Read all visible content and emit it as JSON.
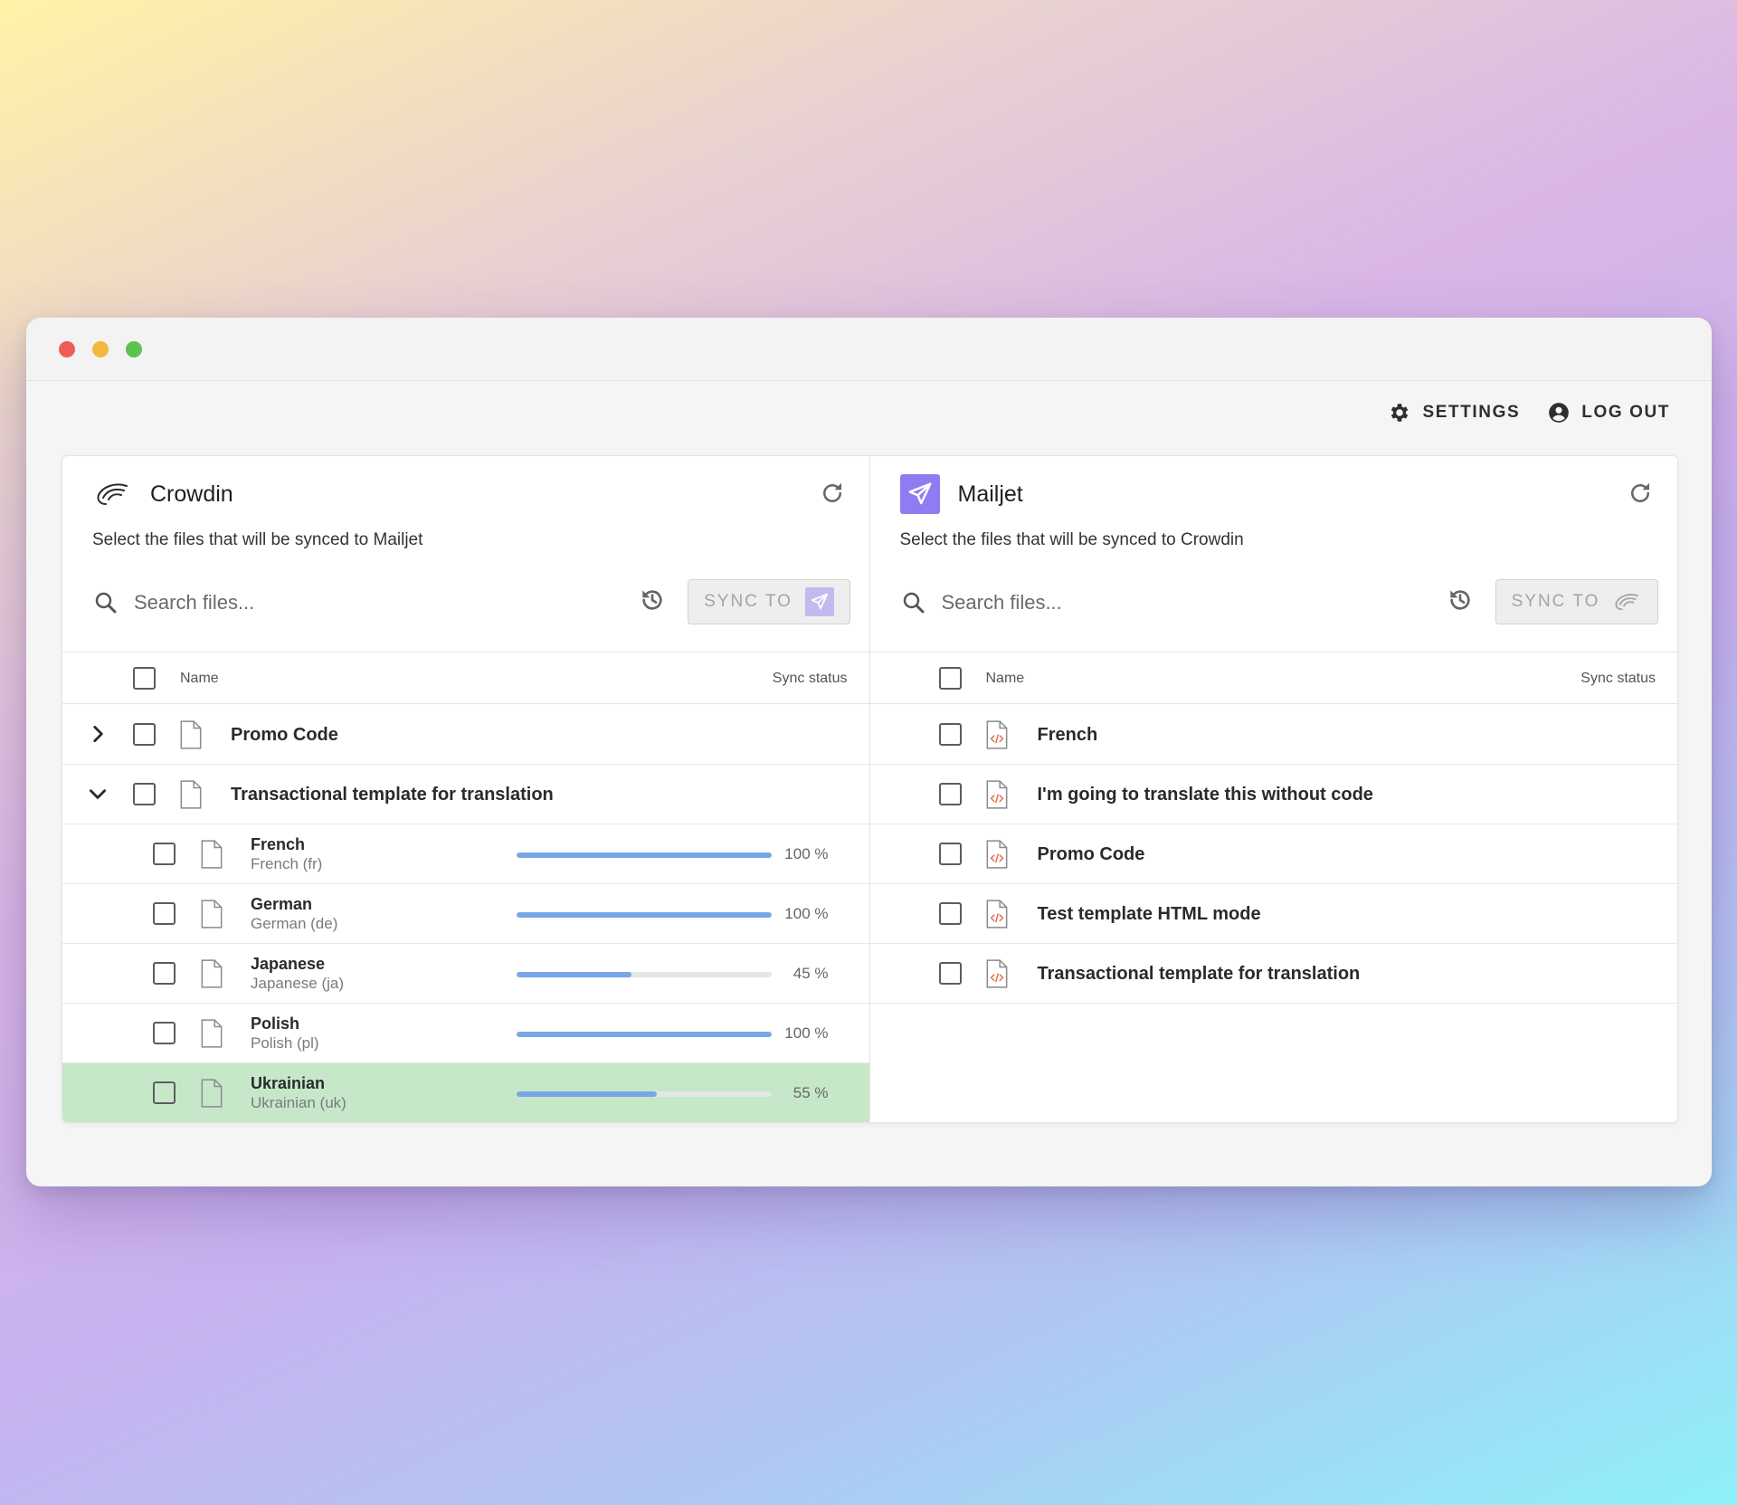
{
  "topbar": {
    "settings": "SETTINGS",
    "logout": "LOG OUT"
  },
  "left_panel": {
    "title": "Crowdin",
    "subtitle": "Select the files that will be synced to Mailjet",
    "search_placeholder": "Search files...",
    "sync_label": "SYNC TO",
    "col_name": "Name",
    "col_sync": "Sync status",
    "rows": [
      {
        "name": "Promo Code",
        "expanded": false
      },
      {
        "name": "Transactional template for translation",
        "expanded": true
      }
    ],
    "languages": [
      {
        "name": "French",
        "code": "French  (fr)",
        "progress": 100,
        "pct": "100 %"
      },
      {
        "name": "German",
        "code": "German  (de)",
        "progress": 100,
        "pct": "100 %"
      },
      {
        "name": "Japanese",
        "code": "Japanese  (ja)",
        "progress": 45,
        "pct": "45 %"
      },
      {
        "name": "Polish",
        "code": "Polish  (pl)",
        "progress": 100,
        "pct": "100 %"
      },
      {
        "name": "Ukrainian",
        "code": "Ukrainian  (uk)",
        "progress": 55,
        "pct": "55 %",
        "highlighted": true
      }
    ]
  },
  "right_panel": {
    "title": "Mailjet",
    "subtitle": "Select the files that will be synced to Crowdin",
    "search_placeholder": "Search files...",
    "sync_label": "SYNC TO",
    "col_name": "Name",
    "col_sync": "Sync status",
    "rows": [
      {
        "name": "French"
      },
      {
        "name": "I'm going to translate this without code"
      },
      {
        "name": "Promo Code"
      },
      {
        "name": "Test template HTML mode"
      },
      {
        "name": "Transactional template for translation"
      }
    ]
  },
  "colors": {
    "progress": "#78a6e6",
    "highlight_row": "#c6e8c9",
    "mailjet_brand": "#8f7cf2"
  }
}
